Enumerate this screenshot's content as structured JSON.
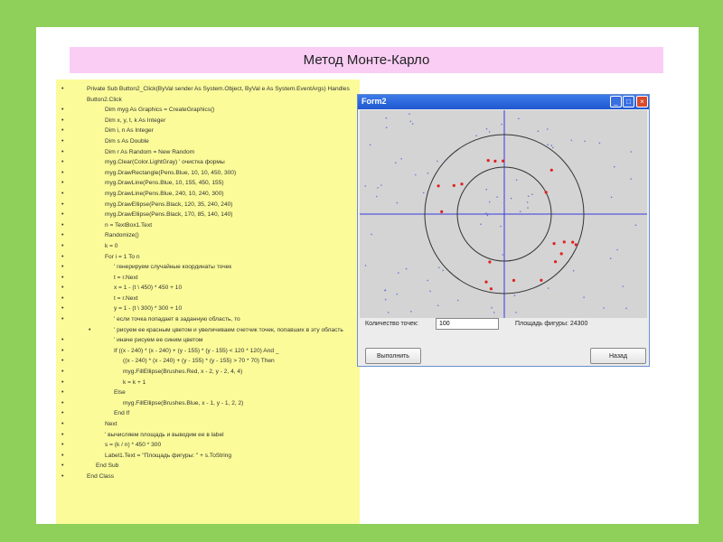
{
  "slide": {
    "title": "Метод Монте-Карло",
    "code_lines": [
      {
        "text": "Private Sub Button2_Click(ByVal sender As System.Object, ByVal e As System.EventArgs) Handles Button2.Click",
        "indent": 0,
        "bullet": true
      },
      {
        "text": "Dim myg As Graphics = CreateGraphics()",
        "indent": 2,
        "bullet": true
      },
      {
        "text": "Dim x, y, t, k As Integer",
        "indent": 2,
        "bullet": true
      },
      {
        "text": "Dim i, n As Integer",
        "indent": 2,
        "bullet": true
      },
      {
        "text": "Dim s As Double",
        "indent": 2,
        "bullet": true
      },
      {
        "text": "Dim r As Random = New Random",
        "indent": 2,
        "bullet": true
      },
      {
        "text": "myg.Clear(Color.LightGray)   ' очистка формы",
        "indent": 2,
        "bullet": true
      },
      {
        "text": "myg.DrawRectangle(Pens.Blue, 10, 10, 450, 300)",
        "indent": 2,
        "bullet": true
      },
      {
        "text": "myg.DrawLine(Pens.Blue, 10, 155, 450, 155)",
        "indent": 2,
        "bullet": true
      },
      {
        "text": "myg.DrawLine(Pens.Blue, 240, 10, 240, 300)",
        "indent": 2,
        "bullet": true
      },
      {
        "text": "myg.DrawEllipse(Pens.Black, 120, 35, 240, 240)",
        "indent": 2,
        "bullet": true
      },
      {
        "text": "myg.DrawEllipse(Pens.Black, 170, 85, 140, 140)",
        "indent": 2,
        "bullet": true
      },
      {
        "text": "n = TextBox1.Text",
        "indent": 2,
        "bullet": true
      },
      {
        "text": "Randomize()",
        "indent": 2,
        "bullet": true
      },
      {
        "text": "k = 0",
        "indent": 2,
        "bullet": true
      },
      {
        "text": "For i = 1 To n",
        "indent": 2,
        "bullet": true
      },
      {
        "text": "' генерируем случайные координаты точек",
        "indent": 3,
        "bullet": true
      },
      {
        "text": "t = r.Next",
        "indent": 3,
        "bullet": true
      },
      {
        "text": "x = 1 - (t \\ 450) * 450 + 10",
        "indent": 3,
        "bullet": true
      },
      {
        "text": "t = r.Next",
        "indent": 3,
        "bullet": true
      },
      {
        "text": "y = 1 - (t \\ 300) * 300 + 10",
        "indent": 3,
        "bullet": true
      },
      {
        "text": "' если точка попадает в заданную область, то",
        "indent": 3,
        "bullet": true
      },
      {
        "text": "' рисуем ее красным цветом и увеличиваем счетчик точек, попавших в эту область",
        "indent": 3,
        "bullet": true
      },
      {
        "text": "' иначе рисуем ее синим цветом",
        "indent": 3,
        "bullet": true
      },
      {
        "text": "If ((x - 240) * (x - 240) + (y - 155) * (y - 155) < 120 * 120) And _",
        "indent": 3,
        "bullet": true
      },
      {
        "text": "((x - 240) * (x - 240) + (y - 155) * (y - 155) > 70 * 70) Then",
        "indent": 4,
        "bullet": true
      },
      {
        "text": "myg.FillEllipse(Brushes.Red, x - 2, y - 2, 4, 4)",
        "indent": 4,
        "bullet": true
      },
      {
        "text": "k = k + 1",
        "indent": 4,
        "bullet": true
      },
      {
        "text": "Else",
        "indent": 3,
        "bullet": true
      },
      {
        "text": "myg.FillEllipse(Brushes.Blue, x - 1, y - 1, 2, 2)",
        "indent": 4,
        "bullet": true
      },
      {
        "text": "End If",
        "indent": 3,
        "bullet": true
      },
      {
        "text": "Next",
        "indent": 2,
        "bullet": true
      },
      {
        "text": "' вычисляем площадь и выводим ее в label",
        "indent": 2,
        "bullet": true
      },
      {
        "text": "s = (k / n) * 450 * 300",
        "indent": 2,
        "bullet": true
      },
      {
        "text": "Label1.Text = \"Площадь фигуры: \" + s.ToString",
        "indent": 2,
        "bullet": true
      },
      {
        "text": "End Sub",
        "indent": 1,
        "bullet": true
      },
      {
        "text": "End Class",
        "indent": 0,
        "bullet": true
      }
    ]
  },
  "form": {
    "title": "Form2",
    "count_label": "Количество точек:",
    "count_value": "100",
    "area_label": "Площадь фигуры: 24300",
    "run_button": "Выполнить",
    "back_button": "Назад",
    "colors": {
      "background": "#d4d4d4",
      "axis": "#3a3ae0",
      "circle": "#333333",
      "inside": "#e02020",
      "outside": "#6a7ad0"
    }
  }
}
